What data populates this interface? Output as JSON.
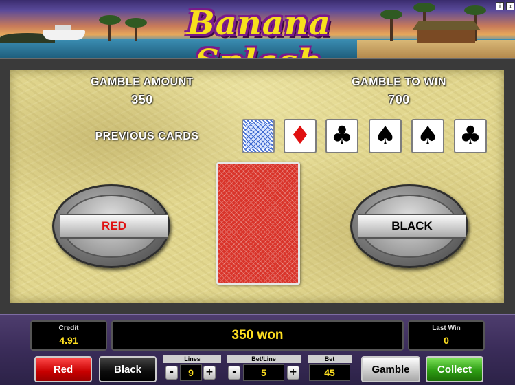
{
  "header": {
    "title": "Banana Splash"
  },
  "gamble": {
    "amount_label": "GAMBLE AMOUNT",
    "amount_value": "350",
    "to_win_label": "GAMBLE TO WIN",
    "to_win_value": "700",
    "previous_cards_label": "PREVIOUS CARDS",
    "previous_cards": [
      {
        "suit": "card-back",
        "glyph": ""
      },
      {
        "suit": "diamond",
        "glyph": "♦"
      },
      {
        "suit": "club",
        "glyph": "♣"
      },
      {
        "suit": "spade",
        "glyph": "♠"
      },
      {
        "suit": "spade",
        "glyph": "♠"
      },
      {
        "suit": "club",
        "glyph": "♣"
      }
    ],
    "red_button": "RED",
    "black_button": "BLACK",
    "red_color": "#e01010",
    "black_color": "#000000"
  },
  "console": {
    "credit_label": "Credit",
    "credit_value": "4.91",
    "message": "350 won",
    "last_win_label": "Last Win",
    "last_win_value": "0",
    "red_label": "Red",
    "black_label": "Black",
    "lines_label": "Lines",
    "lines_value": "9",
    "bet_line_label": "Bet/Line",
    "bet_line_value": "5",
    "bet_label": "Bet",
    "bet_value": "45",
    "gamble_label": "Gamble",
    "collect_label": "Collect",
    "minus": "-",
    "plus": "+",
    "value_color": "#ffe020"
  },
  "window": {
    "info_icon": "i",
    "close_icon": "x"
  }
}
